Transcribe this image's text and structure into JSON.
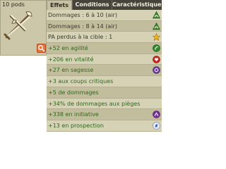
{
  "item": {
    "pods": "10 pods",
    "icon": "crossed-bones-weapon-icon",
    "zoom_icon": "magnifier-icon"
  },
  "tabs": [
    {
      "label": "Effets",
      "active": true
    },
    {
      "label": "Conditions",
      "active": false
    },
    {
      "label": "Caractéristiques",
      "active": false
    }
  ],
  "effects": [
    {
      "text": "Dommages : 6 à 10 (air)",
      "color": "dark",
      "icon": "air-damage-icon"
    },
    {
      "text": "Dommages : 8 à 14 (air)",
      "color": "dark",
      "icon": "air-damage-icon"
    },
    {
      "text": "PA perdus à la cible : 1",
      "color": "dark",
      "icon": "star-ap-icon"
    },
    {
      "text": "+52 en agilité",
      "color": "green",
      "icon": "agility-icon"
    },
    {
      "text": "+206 en vitalité",
      "color": "green",
      "icon": "vitality-heart-icon"
    },
    {
      "text": "+27 en sagesse",
      "color": "green",
      "icon": "wisdom-icon"
    },
    {
      "text": "+3 aux coups critiques",
      "color": "green",
      "icon": ""
    },
    {
      "text": "+5 de dommages",
      "color": "green",
      "icon": ""
    },
    {
      "text": "+34% de dommages aux pièges",
      "color": "green",
      "icon": ""
    },
    {
      "text": "+338 en initiative",
      "color": "green",
      "icon": "initiative-icon"
    },
    {
      "text": "+13 en prospection",
      "color": "green",
      "icon": "prospection-icon"
    }
  ]
}
